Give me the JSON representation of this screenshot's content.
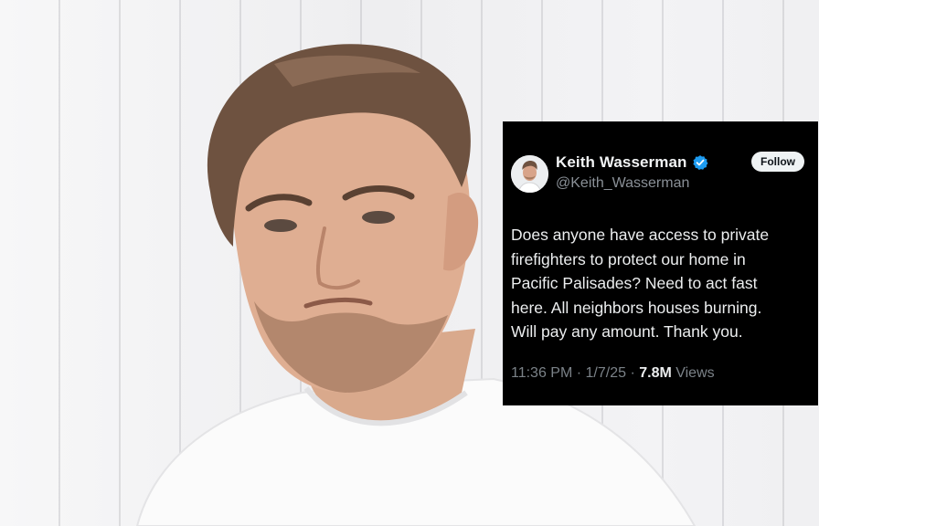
{
  "tweet": {
    "display_name": "Keith Wasserman",
    "handle": "@Keith_Wasserman",
    "follow_label": "Follow",
    "text_lines": [
      "Does anyone have access to private",
      "firefighters to protect our home in",
      "Pacific Palisades? Need to act fast",
      "here. All neighbors houses burning.",
      "Will pay any amount. Thank you."
    ],
    "time": "11:36 PM",
    "separator": " · ",
    "date": "1/7/25",
    "views_count": "7.8M",
    "views_label": " Views",
    "verified_icon": "verified-badge-icon",
    "colors": {
      "background": "#000000",
      "verified": "#1d9bf0",
      "follow_button": "#eff3f4"
    }
  },
  "photo": {
    "subject": "man-portrait-photo"
  }
}
